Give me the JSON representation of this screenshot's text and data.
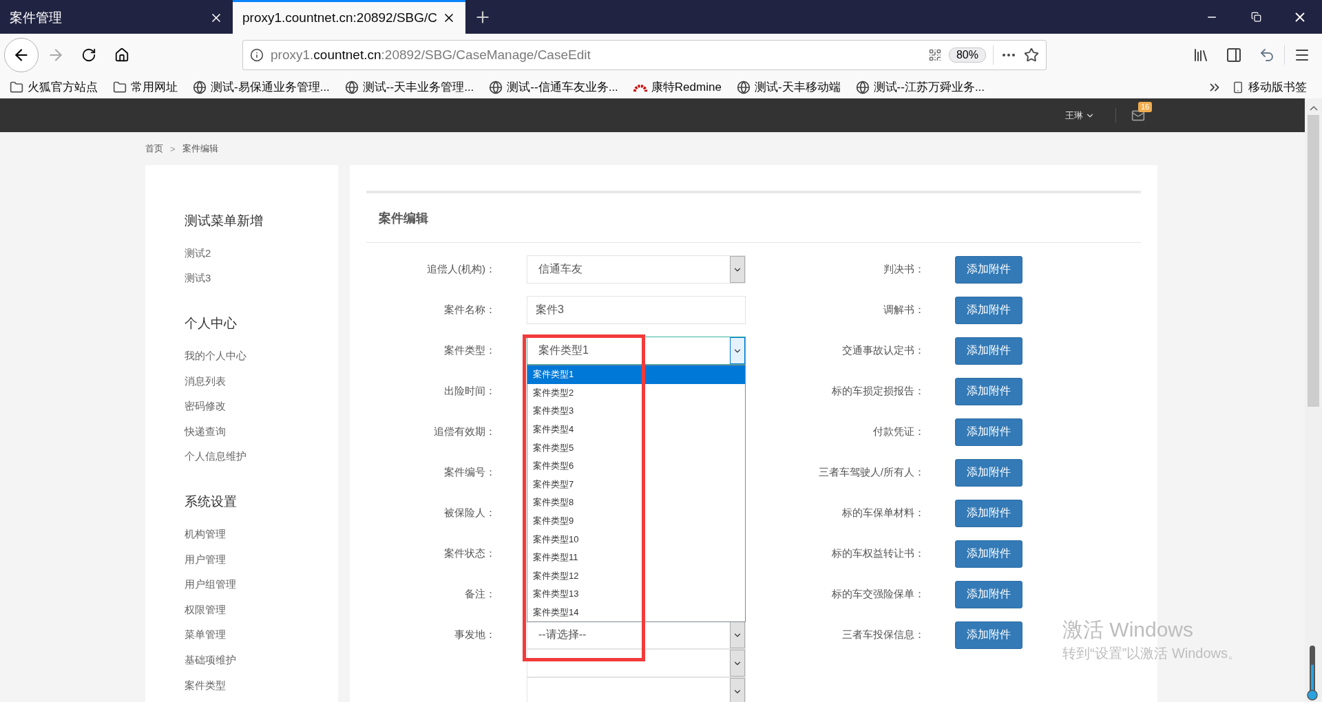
{
  "browser": {
    "tabs": [
      {
        "title": "案件管理",
        "selected": false
      },
      {
        "title": "proxy1.countnet.cn:20892/SBG/C",
        "selected": true
      }
    ],
    "url": {
      "prefix": "proxy1.",
      "domain": "countnet.cn",
      "rest": ":20892/SBG/CaseManage/CaseEdit"
    },
    "zoom": "80%",
    "bookmarks": [
      {
        "kind": "folder",
        "label": "火狐官方站点"
      },
      {
        "kind": "folder",
        "label": "常用网址"
      },
      {
        "kind": "globe",
        "label": "测试-易保通业务管理..."
      },
      {
        "kind": "globe",
        "label": "测试--天丰业务管理..."
      },
      {
        "kind": "globe",
        "label": "测试--信通车友业务..."
      },
      {
        "kind": "redmine",
        "label": "康特Redmine"
      },
      {
        "kind": "globe",
        "label": "测试-天丰移动端"
      },
      {
        "kind": "globe",
        "label": "测试--江苏万舜业务..."
      }
    ],
    "mobile_bookmarks": "移动版书签"
  },
  "header": {
    "user": "王琳",
    "mail_badge": "16"
  },
  "breadcrumb": {
    "items": [
      "首页",
      "案件编辑"
    ],
    "separator": ">"
  },
  "sidebar": {
    "groups": [
      {
        "title": "测试菜单新增",
        "items": [
          "测试2",
          "测试3"
        ]
      },
      {
        "title": "个人中心",
        "items": [
          "我的个人中心",
          "消息列表",
          "密码修改",
          "快递查询",
          "个人信息维护"
        ]
      },
      {
        "title": "系统设置",
        "items": [
          "机构管理",
          "用户管理",
          "用户组管理",
          "权限管理",
          "菜单管理",
          "基础项维护",
          "案件类型"
        ]
      }
    ]
  },
  "form": {
    "title": "案件编辑",
    "fields": [
      {
        "label": "追偿人(机构)：",
        "kind": "select",
        "value": "信通车友",
        "expanded": false
      },
      {
        "label": "案件名称：",
        "kind": "input",
        "value": "案件3"
      },
      {
        "label": "案件类型：",
        "kind": "select",
        "value": "案件类型1",
        "expanded": true,
        "options": [
          {
            "label": "案件类型1",
            "selected": true
          },
          {
            "label": "案件类型2",
            "selected": false
          },
          {
            "label": "案件类型3",
            "selected": false
          },
          {
            "label": "案件类型4",
            "selected": false
          },
          {
            "label": "案件类型5",
            "selected": false
          },
          {
            "label": "案件类型6",
            "selected": false
          },
          {
            "label": "案件类型7",
            "selected": false
          },
          {
            "label": "案件类型8",
            "selected": false
          },
          {
            "label": "案件类型9",
            "selected": false
          },
          {
            "label": "案件类型10",
            "selected": false
          },
          {
            "label": "案件类型11",
            "selected": false
          },
          {
            "label": "案件类型12",
            "selected": false
          },
          {
            "label": "案件类型13",
            "selected": false
          },
          {
            "label": "案件类型14",
            "selected": false
          }
        ]
      },
      {
        "label": "出险时间："
      },
      {
        "label": "追偿有效期："
      },
      {
        "label": "案件编号："
      },
      {
        "label": "被保险人："
      },
      {
        "label": "案件状态："
      },
      {
        "label": "备注："
      },
      {
        "label": "事发地：",
        "kind": "select",
        "value": "--请选择--",
        "expanded": false
      },
      {
        "kind": "select",
        "expanded": false
      },
      {
        "kind": "select",
        "expanded": false
      }
    ],
    "attachments": [
      {
        "label": "判决书：",
        "button": "添加附件"
      },
      {
        "label": "调解书：",
        "button": "添加附件"
      },
      {
        "label": "交通事故认定书：",
        "button": "添加附件"
      },
      {
        "label": "标的车损定损报告：",
        "button": "添加附件"
      },
      {
        "label": "付款凭证：",
        "button": "添加附件"
      },
      {
        "label": "三者车驾驶人/所有人：",
        "button": "添加附件"
      },
      {
        "label": "标的车保单材料：",
        "button": "添加附件"
      },
      {
        "label": "标的车权益转让书：",
        "button": "添加附件"
      },
      {
        "label": "标的车交强险保单：",
        "button": "添加附件"
      },
      {
        "label": "三者车投保信息：",
        "button": "添加附件"
      }
    ]
  },
  "annotations": [
    {
      "kind": "box"
    }
  ],
  "os_overlay": {
    "title": "激活 Windows",
    "subtitle": "转到“设置”以激活 Windows。"
  }
}
